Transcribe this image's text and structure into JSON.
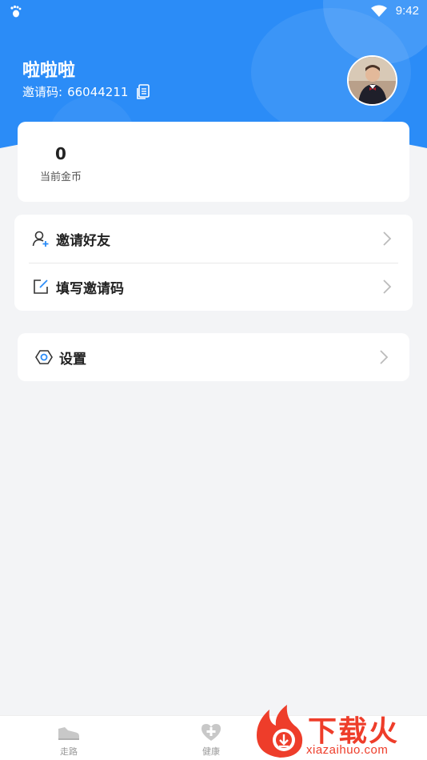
{
  "status_bar": {
    "time": "9:42"
  },
  "profile": {
    "username": "啦啦啦",
    "invite_label": "邀请码:",
    "invite_code": "66044211"
  },
  "coins": {
    "value": "0",
    "label": "当前金币"
  },
  "menu": {
    "items": [
      {
        "label": "邀请好友",
        "icon": "add-user-icon"
      },
      {
        "label": "填写邀请码",
        "icon": "edit-icon"
      }
    ]
  },
  "settings": {
    "label": "设置",
    "icon": "hexagon-settings-icon"
  },
  "bottom_nav": {
    "items": [
      {
        "label": "走路",
        "icon": "shoe-icon"
      },
      {
        "label": "健康",
        "icon": "health-plus-icon"
      }
    ]
  },
  "watermark": {
    "title": "下载火",
    "subtitle": "xiazaihuo.com"
  },
  "colors": {
    "primary": "#2b8cf7",
    "background": "#f3f4f6",
    "watermark": "#ee3d2a"
  }
}
